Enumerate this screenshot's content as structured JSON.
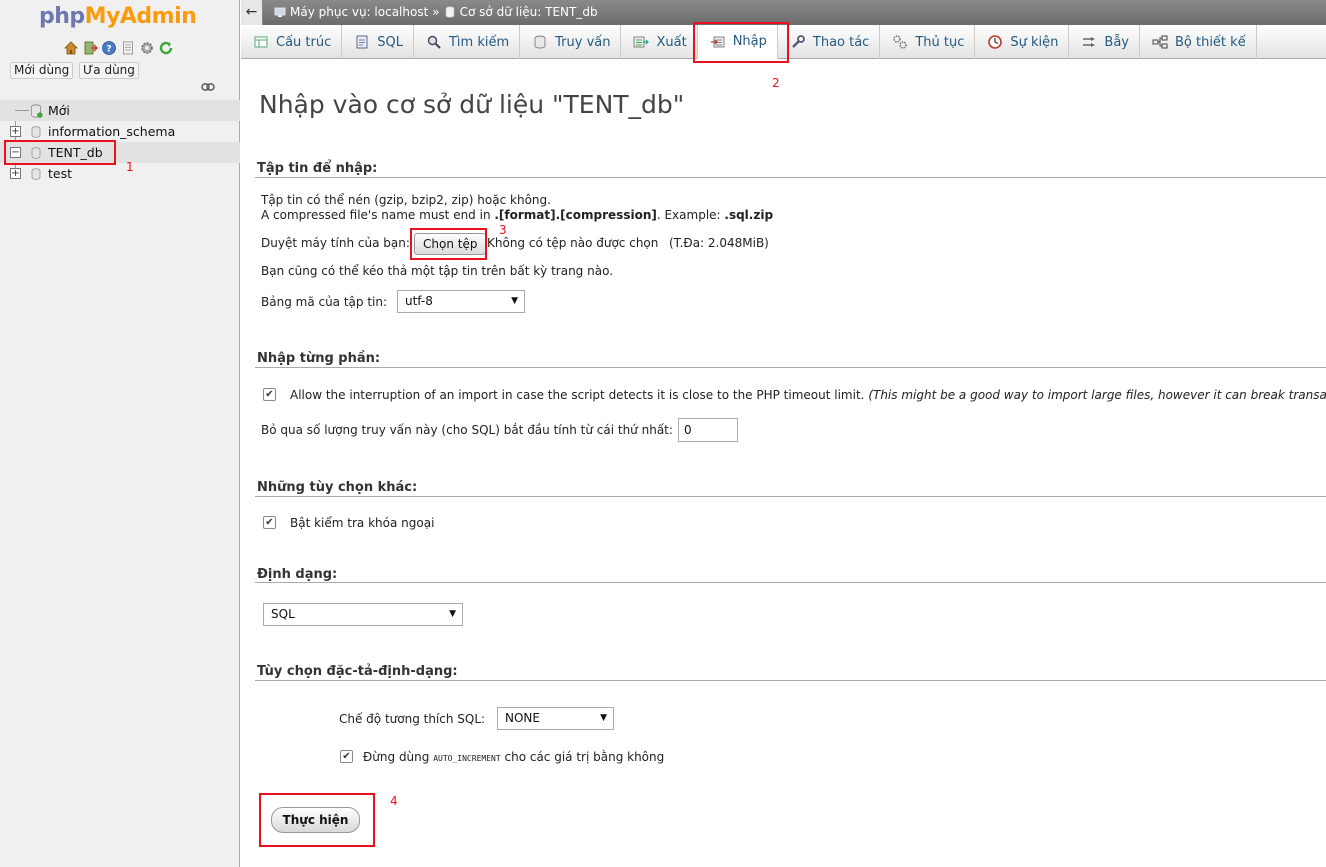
{
  "sidebar": {
    "logo": {
      "php": "php",
      "my": "MyAdmin"
    },
    "quick_icons": [
      "home-icon",
      "exit-icon",
      "help-icon",
      "docs-icon",
      "settings-icon",
      "reload-icon"
    ],
    "recent_label": "Mới dùng",
    "favorites_label": "Ưa dùng",
    "tree": [
      {
        "label": "Mới",
        "kind": "new"
      },
      {
        "label": "information_schema",
        "kind": "db",
        "expander": "+"
      },
      {
        "label": "TENT_db",
        "kind": "db",
        "expander": "−",
        "selected": true
      },
      {
        "label": "test",
        "kind": "db",
        "expander": "+"
      }
    ]
  },
  "topbar": {
    "back_label": "←",
    "server": "Máy phục vụ: localhost",
    "separator": "»",
    "database": "Cơ sở dữ liệu: TENT_db"
  },
  "tabs": [
    {
      "label": "Cấu trúc",
      "icon": "structure-icon"
    },
    {
      "label": "SQL",
      "icon": "sql-icon"
    },
    {
      "label": "Tìm kiếm",
      "icon": "search-icon"
    },
    {
      "label": "Truy vấn",
      "icon": "query-icon"
    },
    {
      "label": "Xuất",
      "icon": "export-icon"
    },
    {
      "label": "Nhập",
      "icon": "import-icon",
      "active": true
    },
    {
      "label": "Thao tác",
      "icon": "wrench-icon"
    },
    {
      "label": "Thủ tục",
      "icon": "routines-icon"
    },
    {
      "label": "Sự kiện",
      "icon": "clock-icon"
    },
    {
      "label": "Bẫy",
      "icon": "triggers-icon"
    },
    {
      "label": "Bộ thiết kế",
      "icon": "designer-icon"
    }
  ],
  "main": {
    "title": "Nhập vào cơ sở dữ liệu \"TENT_db\"",
    "file_section": {
      "legend": "Tập tin để nhập:",
      "line1": "Tập tin có thể nén (gzip, bzip2, zip) hoặc không.",
      "line2_prefix": "A compressed file's name must end in ",
      "line2_format": ".[format].[compression]",
      "line2_mid": ". Example: ",
      "line2_example": ".sql.zip",
      "browse_label": "Duyệt máy tính của bạn:",
      "choose_button": "Chọn tệp",
      "no_file": "Không có tệp nào được chọn",
      "max_size": "(T.Đa: 2.048MiB)",
      "drag_hint": "Bạn cũng có thể kéo thả một tập tin trên bất kỳ trang nào.",
      "charset_label": "Bảng mã của tập tin:",
      "charset_value": "utf-8"
    },
    "partial_section": {
      "legend": "Nhập từng phần:",
      "allow_interrupt": "Allow the interruption of an import in case the script detects it is close to the PHP timeout limit.",
      "allow_interrupt_note": "(This might be a good way to import large files, however it can break transactions.)",
      "allow_interrupt_checked": true,
      "skip_label": "Bỏ qua số lượng truy vấn này (cho SQL) bắt đầu tính từ cái thứ nhất:",
      "skip_value": "0"
    },
    "other_section": {
      "legend": "Những tùy chọn khác:",
      "fk_label": "Bật kiểm tra khóa ngoại",
      "fk_checked": true
    },
    "format_section": {
      "legend": "Định dạng:",
      "format_value": "SQL"
    },
    "format_options_section": {
      "legend": "Tùy chọn đặc-tả-định-dạng:",
      "compat_label": "Chế độ tương thích SQL:",
      "compat_value": "NONE",
      "auto_inc_prefix": "Đừng dùng",
      "auto_inc_code": "AUTO_INCREMENT",
      "auto_inc_suffix": "cho các giá trị bằng không",
      "auto_inc_checked": true
    },
    "go_button": "Thực hiện"
  },
  "annotations": {
    "color": "#e8111c",
    "labels": [
      "1",
      "2",
      "3",
      "4"
    ]
  },
  "colors": {
    "link": "#235a81",
    "logo_php": "#6c78af",
    "logo_my": "#f89c0e"
  }
}
